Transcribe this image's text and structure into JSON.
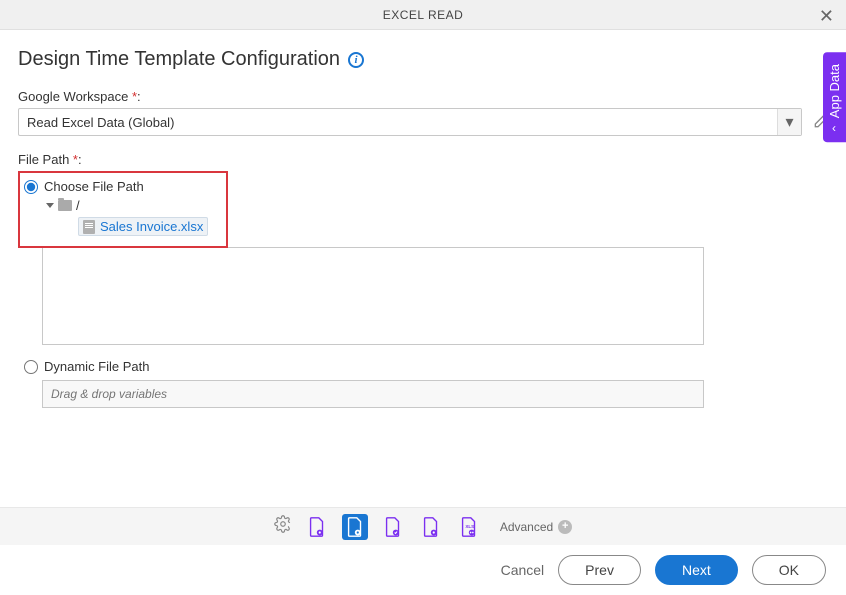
{
  "header": {
    "title": "EXCEL READ"
  },
  "section": {
    "title": "Design Time Template Configuration"
  },
  "fields": {
    "workspace": {
      "label": "Google Workspace ",
      "value": "Read Excel Data (Global)"
    },
    "filepath": {
      "label": "File Path ",
      "choose_label": "Choose File Path",
      "root_label": "/",
      "file_name": "Sales Invoice.xlsx",
      "dynamic_label": "Dynamic File Path",
      "dynamic_placeholder": "Drag & drop variables"
    }
  },
  "sidetab": {
    "label": "App Data"
  },
  "footer": {
    "advanced": "Advanced",
    "cancel": "Cancel",
    "prev": "Prev",
    "next": "Next",
    "ok": "OK"
  }
}
